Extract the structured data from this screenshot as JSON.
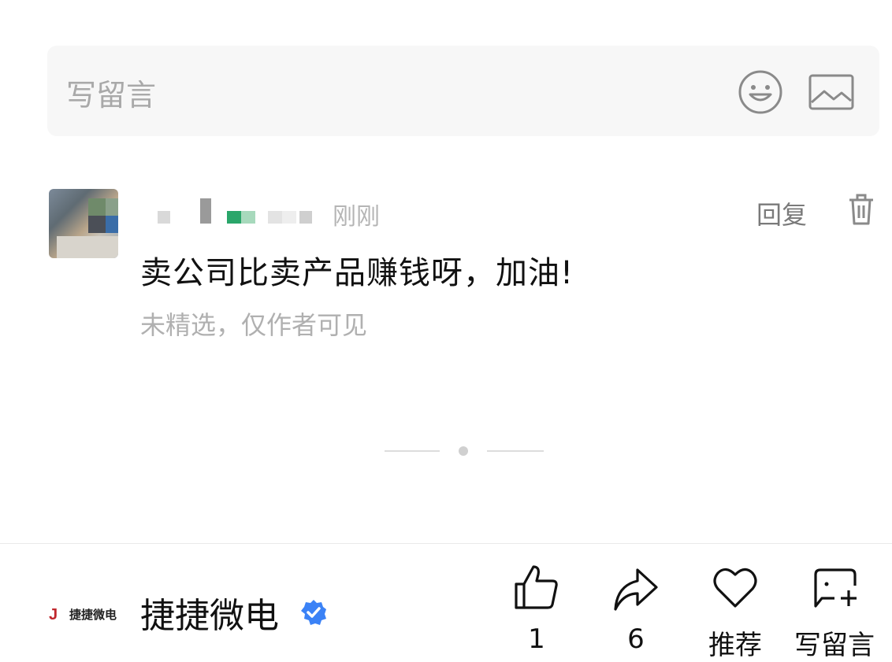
{
  "comment_input": {
    "placeholder": "写留言",
    "emoji_icon": "smile-icon",
    "image_icon": "image-icon"
  },
  "comment": {
    "nickname": "(pixelated)",
    "time": "刚刚",
    "reply_label": "回复",
    "delete_icon": "trash-icon",
    "text": "卖公司比卖产品赚钱呀，加油!",
    "note": "未精选，仅作者可见"
  },
  "account": {
    "logo_text": "捷捷微电",
    "name": "捷捷微电",
    "verified_color": "#3b82f6"
  },
  "actions": {
    "like": {
      "icon": "thumbs-up-icon",
      "label": "1"
    },
    "share": {
      "icon": "share-arrow-icon",
      "label": "6"
    },
    "recommend": {
      "icon": "heart-icon",
      "label": "推荐"
    },
    "comment": {
      "icon": "write-comment-icon",
      "label": "写留言"
    }
  }
}
